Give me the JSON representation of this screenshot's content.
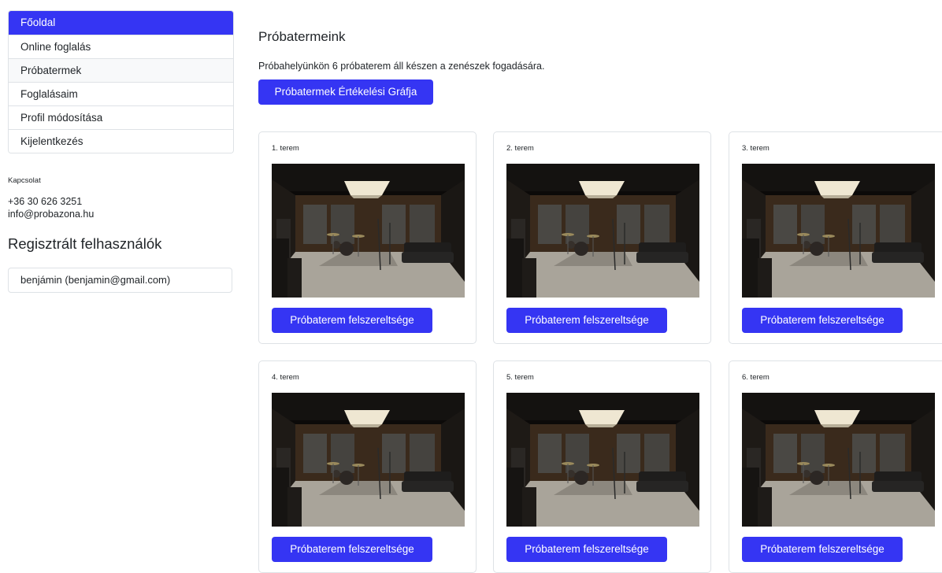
{
  "sidebar": {
    "items": [
      {
        "label": "Főoldal"
      },
      {
        "label": "Online foglalás"
      },
      {
        "label": "Próbatermek"
      },
      {
        "label": "Foglalásaim"
      },
      {
        "label": "Profil módosítása"
      },
      {
        "label": "Kijelentkezés"
      }
    ],
    "contact_label": "Kapcsolat",
    "phone": "+36 30 626 3251",
    "email": "info@probazona.hu",
    "users_title": "Regisztrált felhasználók",
    "users": [
      {
        "label": "benjámin (benjamin@gmail.com)"
      }
    ]
  },
  "main": {
    "title": "Próbatermeink",
    "description": "Próbahelyünkön 6 próbaterem áll készen a zenészek fogadására.",
    "graph_button": "Próbatermek Értékelési Gráfja",
    "rooms": [
      {
        "label": "1. terem",
        "button": "Próbaterem felszereltsége"
      },
      {
        "label": "2. terem",
        "button": "Próbaterem felszereltsége"
      },
      {
        "label": "3. terem",
        "button": "Próbaterem felszereltsége"
      },
      {
        "label": "4. terem",
        "button": "Próbaterem felszereltsége"
      },
      {
        "label": "5. terem",
        "button": "Próbaterem felszereltsége"
      },
      {
        "label": "6. terem",
        "button": "Próbaterem felszereltsége"
      }
    ]
  },
  "colors": {
    "accent": "#3535f3",
    "border": "#dee2e6"
  }
}
